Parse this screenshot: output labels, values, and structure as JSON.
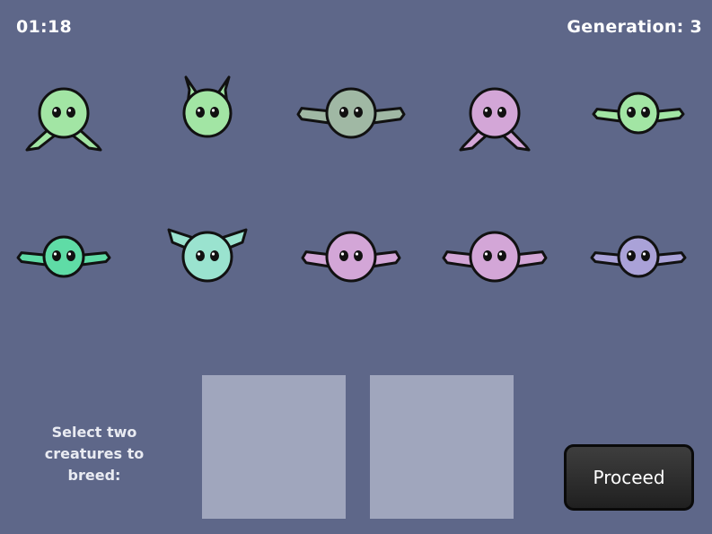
{
  "hud": {
    "timer": "01:18",
    "generation": "Generation: 3"
  },
  "prompt": "Select two creatures to breed:",
  "proceed_label": "Proceed",
  "creatures": [
    {
      "color": "#a2e5a4",
      "appendage": "legs-down"
    },
    {
      "color": "#a2e5a4",
      "appendage": "ears-up"
    },
    {
      "color": "#a0b8a4",
      "appendage": "wings-side"
    },
    {
      "color": "#d3a6d7",
      "appendage": "legs-down"
    },
    {
      "color": "#a2e5a4",
      "appendage": "wings-side"
    },
    {
      "color": "#5fdca6",
      "appendage": "wings-side"
    },
    {
      "color": "#9ae3cf",
      "appendage": "ears-up"
    },
    {
      "color": "#d3a6d7",
      "appendage": "wings-side"
    },
    {
      "color": "#d3a6d7",
      "appendage": "wings-side"
    },
    {
      "color": "#aaa2d8",
      "appendage": "wings-side"
    }
  ],
  "breeding_slots": [
    {
      "filled": false
    },
    {
      "filled": false
    }
  ]
}
